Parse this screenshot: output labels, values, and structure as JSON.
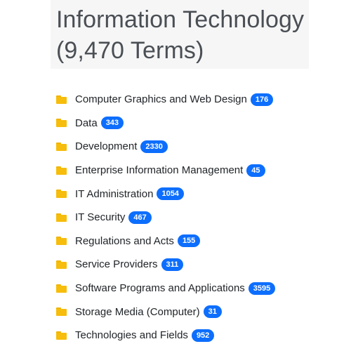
{
  "header": {
    "title_line1": "Information Technology",
    "title_line2": "(9,470 Terms)"
  },
  "colors": {
    "folder": "#f7bd0c",
    "badge": "#0d6efd",
    "title_bg": "#f6f6f6"
  },
  "categories": [
    {
      "label": "Computer Graphics and Web Design",
      "count": "176",
      "icon": "folder-icon"
    },
    {
      "label": "Data",
      "count": "343",
      "icon": "folder-icon"
    },
    {
      "label": "Development",
      "count": "2330",
      "icon": "folder-icon"
    },
    {
      "label": "Enterprise Information Management",
      "count": "45",
      "icon": "folder-icon"
    },
    {
      "label": "IT Administration",
      "count": "1054",
      "icon": "folder-icon"
    },
    {
      "label": "IT Security",
      "count": "467",
      "icon": "folder-icon"
    },
    {
      "label": "Regulations and Acts",
      "count": "155",
      "icon": "folder-icon"
    },
    {
      "label": "Service Providers",
      "count": "311",
      "icon": "folder-icon"
    },
    {
      "label": "Software Programs and Applications",
      "count": "3595",
      "icon": "folder-icon"
    },
    {
      "label": "Storage Media (Computer)",
      "count": "31",
      "icon": "folder-icon"
    },
    {
      "label": "Technologies and Fields",
      "count": "952",
      "icon": "folder-icon"
    }
  ]
}
